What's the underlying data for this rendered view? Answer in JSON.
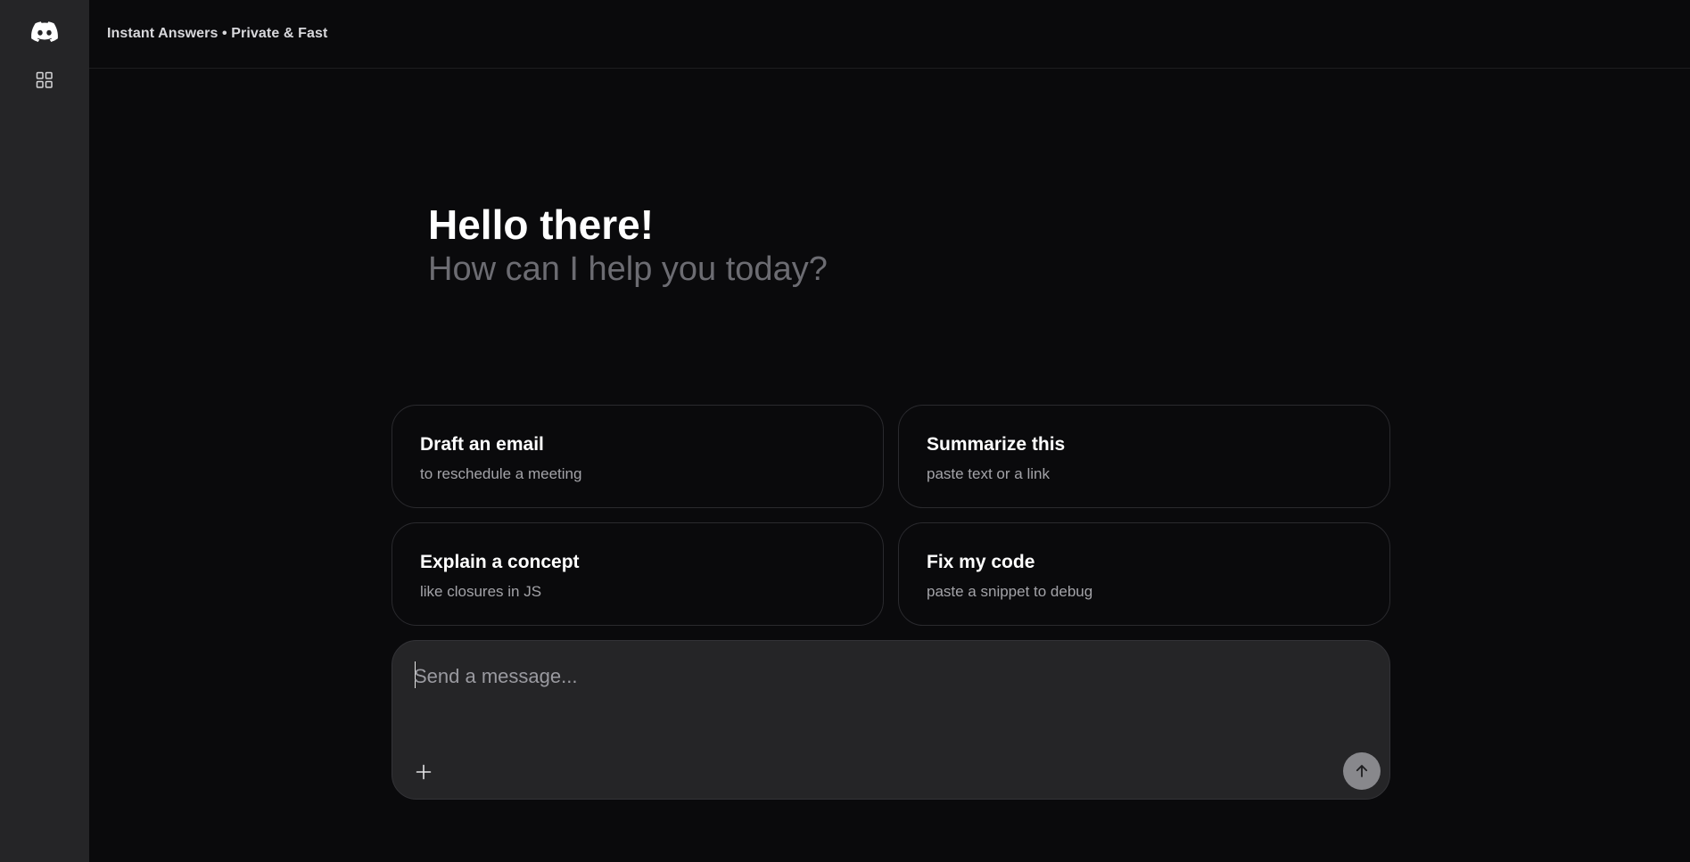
{
  "sidebar": {
    "logo_icon": "discord-logo-icon",
    "apps_icon": "apps-grid-icon"
  },
  "header": {
    "title": "Instant Answers • Private & Fast"
  },
  "greeting": {
    "title": "Hello there!",
    "subtitle": "How can I help you today?"
  },
  "suggestions": [
    {
      "title": "Draft an email",
      "subtitle": "to reschedule a meeting"
    },
    {
      "title": "Summarize this",
      "subtitle": "paste text or a link"
    },
    {
      "title": "Explain a concept",
      "subtitle": "like closures in JS"
    },
    {
      "title": "Fix my code",
      "subtitle": "paste a snippet to debug"
    }
  ],
  "composer": {
    "placeholder": "Send a message...",
    "value": "",
    "attach_icon": "plus-icon",
    "send_icon": "arrow-up-icon"
  },
  "colors": {
    "background": "#0a0a0c",
    "sidebar": "#252527",
    "composer": "#252527",
    "send_button": "#88888c",
    "muted_text": "#6c6c72"
  }
}
